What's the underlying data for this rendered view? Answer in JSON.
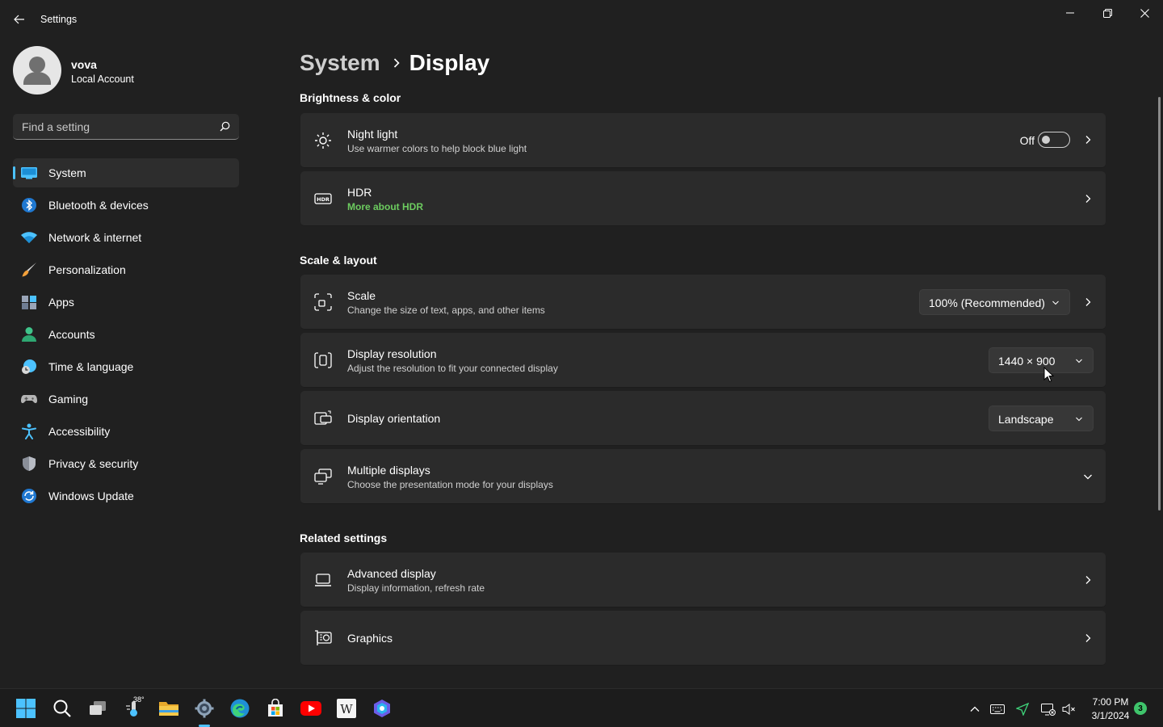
{
  "window": {
    "app_title": "Settings"
  },
  "profile": {
    "name": "vova",
    "account_type": "Local Account"
  },
  "search": {
    "placeholder": "Find a setting"
  },
  "sidebar": {
    "items": [
      {
        "label": "System",
        "icon": "system-icon",
        "active": true
      },
      {
        "label": "Bluetooth & devices",
        "icon": "bluetooth-icon"
      },
      {
        "label": "Network & internet",
        "icon": "wifi-icon"
      },
      {
        "label": "Personalization",
        "icon": "paintbrush-icon"
      },
      {
        "label": "Apps",
        "icon": "apps-icon"
      },
      {
        "label": "Accounts",
        "icon": "person-icon"
      },
      {
        "label": "Time & language",
        "icon": "globe-clock-icon"
      },
      {
        "label": "Gaming",
        "icon": "gamepad-icon"
      },
      {
        "label": "Accessibility",
        "icon": "accessibility-icon"
      },
      {
        "label": "Privacy & security",
        "icon": "shield-icon"
      },
      {
        "label": "Windows Update",
        "icon": "update-icon"
      }
    ]
  },
  "breadcrumb": {
    "parent": "System",
    "current": "Display"
  },
  "sections": {
    "brightness": "Brightness & color",
    "scale_layout": "Scale & layout",
    "related": "Related settings"
  },
  "cards": {
    "night_light": {
      "title": "Night light",
      "subtitle": "Use warmer colors to help block blue light",
      "toggle_state": "Off"
    },
    "hdr": {
      "title": "HDR",
      "link": "More about HDR"
    },
    "scale": {
      "title": "Scale",
      "subtitle": "Change the size of text, apps, and other items",
      "value": "100% (Recommended)"
    },
    "resolution": {
      "title": "Display resolution",
      "subtitle": "Adjust the resolution to fit your connected display",
      "value": "1440 × 900"
    },
    "orientation": {
      "title": "Display orientation",
      "value": "Landscape"
    },
    "multiple": {
      "title": "Multiple displays",
      "subtitle": "Choose the presentation mode for your displays"
    },
    "advanced": {
      "title": "Advanced display",
      "subtitle": "Display information, refresh rate"
    },
    "graphics": {
      "title": "Graphics"
    }
  },
  "taskbar": {
    "weather_temp": "38°",
    "time": "7:00 PM",
    "date": "3/1/2024",
    "notifications": "3"
  },
  "colors": {
    "accent": "#4cc2ff",
    "link_green": "#6ccb5f",
    "background": "#202020",
    "card": "#2b2b2b"
  }
}
